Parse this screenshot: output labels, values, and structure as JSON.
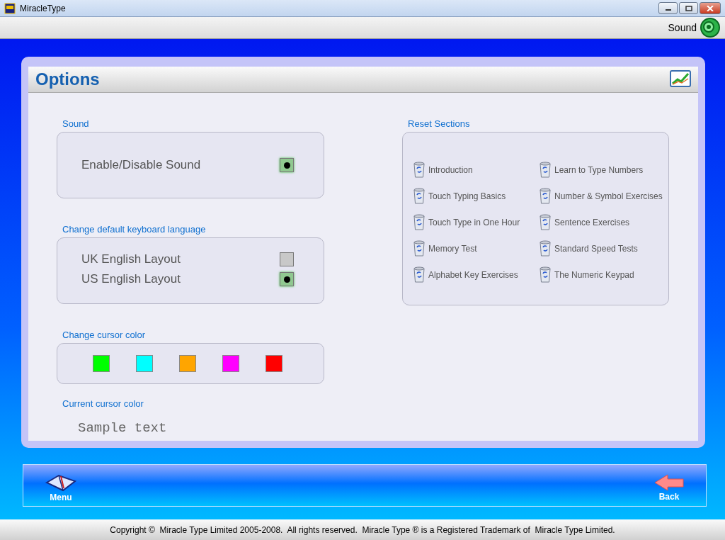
{
  "window": {
    "title": "MiracleType"
  },
  "toolbar": {
    "sound_label": "Sound"
  },
  "panel": {
    "title": "Options"
  },
  "sound": {
    "heading": "Sound",
    "options": [
      {
        "label": "Enable/Disable Sound",
        "checked": true
      }
    ]
  },
  "keyboard_language": {
    "heading": "Change default keyboard language",
    "options": [
      {
        "label": "UK English Layout",
        "selected": false
      },
      {
        "label": "US English Layout",
        "selected": true
      }
    ]
  },
  "cursor_color": {
    "heading": "Change cursor color",
    "swatches": [
      {
        "color": "#00ff00"
      },
      {
        "color": "#00ffff"
      },
      {
        "color": "#ffa500"
      },
      {
        "color": "#ff00ff"
      },
      {
        "color": "#ff0000"
      }
    ]
  },
  "current_cursor": {
    "heading": "Current cursor color",
    "sample": "Sample text"
  },
  "reset_sections": {
    "heading": "Reset Sections",
    "items": [
      {
        "label": "Introduction"
      },
      {
        "label": "Learn to Type Numbers"
      },
      {
        "label": "Touch Typing Basics"
      },
      {
        "label": "Number & Symbol Exercises"
      },
      {
        "label": "Touch Type in One Hour"
      },
      {
        "label": "Sentence Exercises"
      },
      {
        "label": "Memory Test"
      },
      {
        "label": "Standard Speed Tests"
      },
      {
        "label": "Alphabet Key Exercises"
      },
      {
        "label": "The Numeric Keypad"
      }
    ]
  },
  "nav": {
    "menu": "Menu",
    "back": "Back"
  },
  "status_bar": "Copyright ©  Miracle Type Limited 2005-2008.  All rights reserved.  Miracle Type ® is a Registered Trademark of  Miracle Type Limited."
}
